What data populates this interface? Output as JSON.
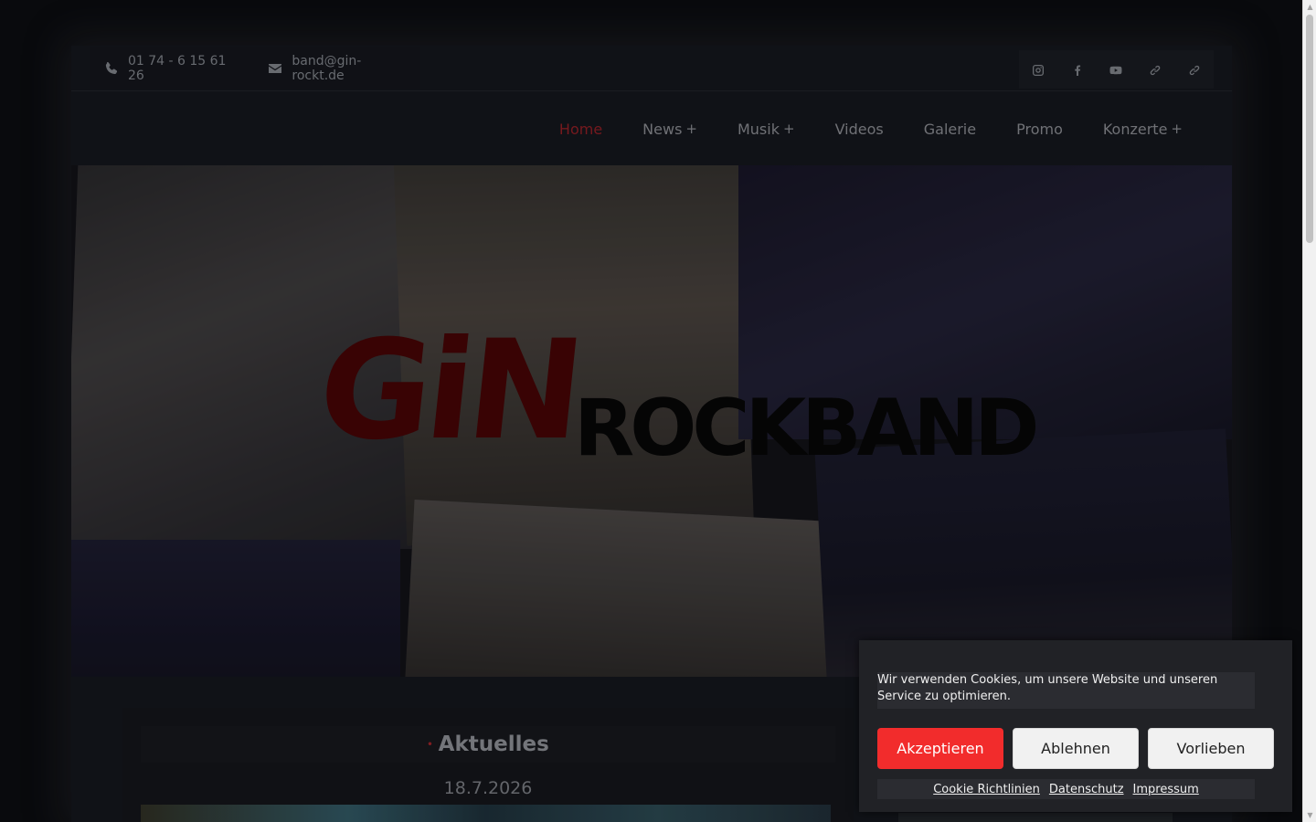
{
  "topbar": {
    "phone": "01 74 - 6 15 61 26",
    "email": "band@gin-rockt.de",
    "social_icons": [
      "instagram-icon",
      "facebook-icon",
      "youtube-icon",
      "link-icon",
      "link-icon"
    ]
  },
  "nav": {
    "items": [
      {
        "label": "Home",
        "has_submenu": false,
        "active": true
      },
      {
        "label": "News",
        "has_submenu": true,
        "active": false
      },
      {
        "label": "Musik",
        "has_submenu": true,
        "active": false
      },
      {
        "label": "Videos",
        "has_submenu": false,
        "active": false
      },
      {
        "label": "Galerie",
        "has_submenu": false,
        "active": false
      },
      {
        "label": "Promo",
        "has_submenu": false,
        "active": false
      },
      {
        "label": "Konzerte",
        "has_submenu": true,
        "active": false
      }
    ],
    "submenu_marker": "+"
  },
  "hero": {
    "logo_word_1": "GiN",
    "logo_word_2": "ROCKBAND"
  },
  "main": {
    "section_title": "Aktuelles",
    "section_bullet": "•",
    "post_date": "18.7.2026"
  },
  "cookie_banner": {
    "message": "Wir verwenden Cookies, um unsere Website und unseren Service zu optimieren.",
    "accept_label": "Akzeptieren",
    "deny_label": "Ablehnen",
    "preferences_label": "Vorlieben",
    "links": [
      "Cookie Richtlinien",
      "Datenschutz",
      "Impressum"
    ]
  },
  "colors": {
    "accent_red": "#f22c2c",
    "active_nav": "#7e1b20",
    "logo_red": "#3d0405",
    "background": "#0a0b0e"
  }
}
